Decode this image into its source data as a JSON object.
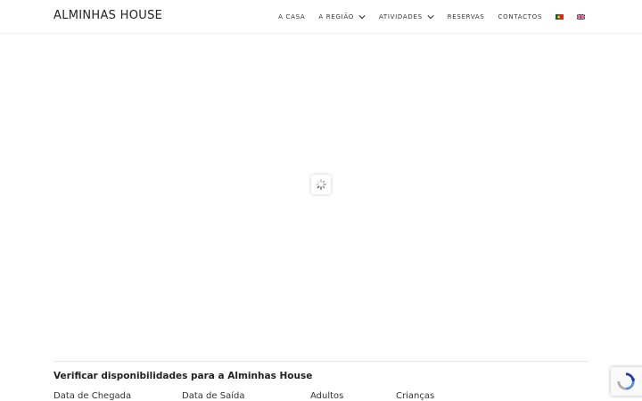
{
  "header": {
    "site_title": "ALMINHAS HOUSE",
    "nav": [
      {
        "label": "A CASA"
      },
      {
        "label": "A REGIÃO"
      },
      {
        "label": "ATIVIDADES"
      },
      {
        "label": "RESERVAS"
      },
      {
        "label": "CONTACTOS"
      }
    ],
    "languages": [
      "pt-flag-icon",
      "en-flag-icon"
    ]
  },
  "slider": {
    "loading_icon": "spinner-icon"
  },
  "booking": {
    "title": "Verificar disponibilidades para a Alminhas House",
    "fields": [
      {
        "label": "Data de Chegada"
      },
      {
        "label": "Data de Saída"
      },
      {
        "label": "Adultos"
      },
      {
        "label": "Crianças"
      }
    ]
  },
  "widgets": {
    "recaptcha_icon": "recaptcha-icon"
  },
  "colors": {
    "text": "#222222",
    "nav_text": "#333333",
    "divider": "#e6e6e6",
    "recaptcha_blue": "#4a90e2"
  }
}
